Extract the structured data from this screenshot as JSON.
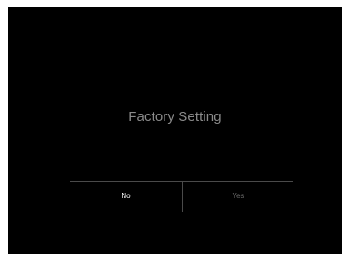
{
  "dialog": {
    "title": "Factory Setting",
    "buttons": {
      "no_label": "No",
      "yes_label": "Yes"
    }
  },
  "colors": {
    "background": "#000000",
    "title_text": "#8a8a8a",
    "selected_button_text": "#ffffff",
    "unselected_button_text": "#6a6a6a",
    "divider": "#4a4a4a"
  }
}
